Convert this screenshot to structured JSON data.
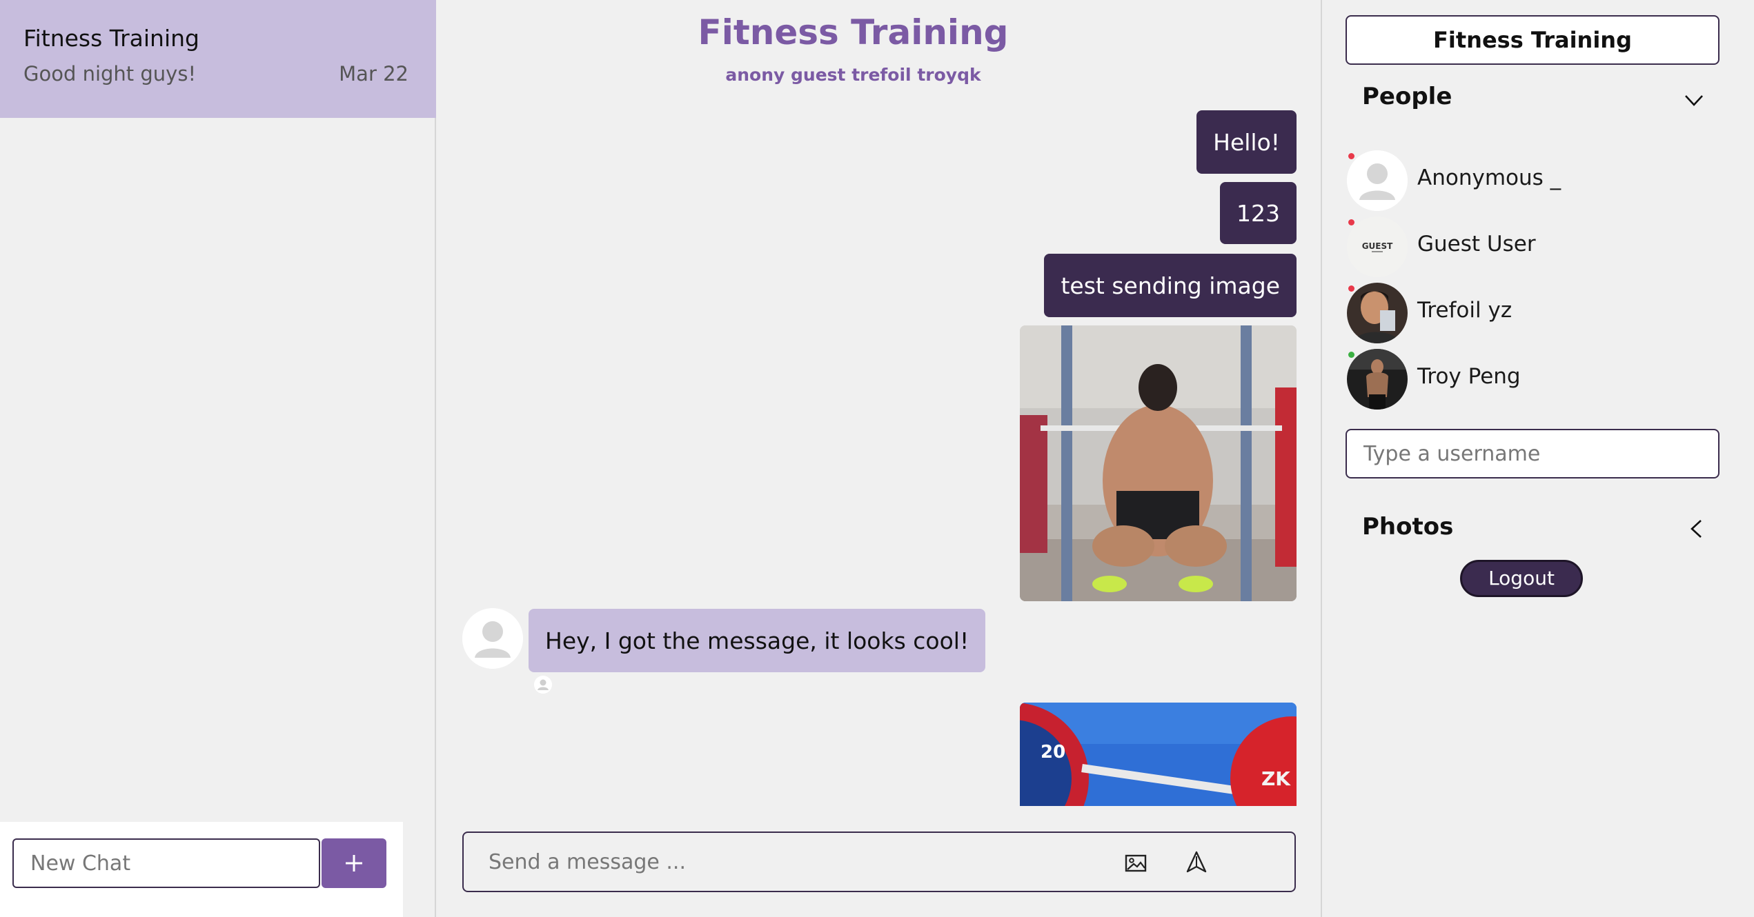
{
  "chat_list": {
    "items": [
      {
        "title": "Fitness Training",
        "preview": "Good night guys!",
        "date": "Mar 22"
      }
    ],
    "new_chat_placeholder": "New Chat",
    "add_icon": "plus-icon"
  },
  "chat": {
    "title": "Fitness Training",
    "members_line": "anony guest trefoil troyqk",
    "messages": {
      "m1": "Hello!",
      "m2": "123",
      "m3": "test sending image",
      "m4_incoming": "Hey, I got the message, it looks cool!"
    },
    "composer_placeholder": "Send a message ...",
    "image_icon": "image-icon",
    "send_icon": "send-icon"
  },
  "details": {
    "room_name": "Fitness Training",
    "people_heading": "People",
    "people": [
      {
        "name": "Anonymous _",
        "status_color": "#e8394a"
      },
      {
        "name": "Guest User",
        "status_color": "#e8394a",
        "avatar_text": "GUEST"
      },
      {
        "name": "Trefoil yz",
        "status_color": "#e8394a"
      },
      {
        "name": "Troy Peng",
        "status_color": "#3cb043"
      }
    ],
    "username_placeholder": "Type a username",
    "photos_heading": "Photos",
    "logout_label": "Logout"
  },
  "colors": {
    "accent": "#7b5aa4",
    "bubble_out": "#3b2b4f",
    "bubble_in": "#c7bddd"
  }
}
